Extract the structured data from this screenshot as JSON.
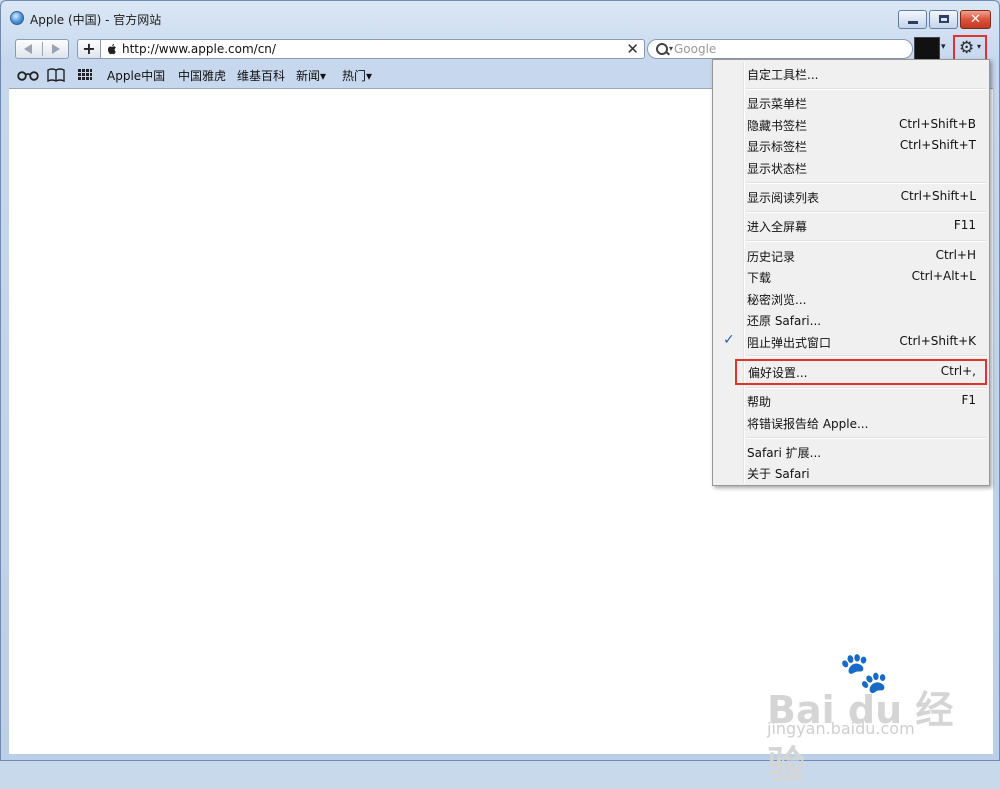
{
  "window": {
    "title": "Apple (中国) - 官方网站",
    "min_glyph": "",
    "max_glyph": "",
    "close_glyph": "✕"
  },
  "toolbar": {
    "add_label": "+",
    "url": "http://www.apple.com/cn/",
    "clear_glyph": "✕",
    "search_placeholder": "Google",
    "search_caret": "▾",
    "page_caret": "▾",
    "gear_glyph": "⚙",
    "gear_caret": "▾"
  },
  "bookmarks": {
    "reading_icon": "glasses-icon",
    "bookmarks_icon": "open-book-icon",
    "topsites_icon": "grid-icon",
    "items": [
      "Apple中国",
      "中国雅虎",
      "维基百科",
      "新闻▾",
      "热门▾"
    ]
  },
  "menu": {
    "items": [
      {
        "label": "自定工具栏...",
        "shortcut": ""
      },
      {
        "label": "显示菜单栏",
        "shortcut": ""
      },
      {
        "label": "隐藏书签栏",
        "shortcut": "Ctrl+Shift+B"
      },
      {
        "label": "显示标签栏",
        "shortcut": "Ctrl+Shift+T"
      },
      {
        "label": "显示状态栏",
        "shortcut": ""
      },
      {
        "label": "显示阅读列表",
        "shortcut": "Ctrl+Shift+L"
      },
      {
        "label": "进入全屏幕",
        "shortcut": "F11"
      },
      {
        "label": "历史记录",
        "shortcut": "Ctrl+H"
      },
      {
        "label": "下载",
        "shortcut": "Ctrl+Alt+L"
      },
      {
        "label": "秘密浏览...",
        "shortcut": ""
      },
      {
        "label": "还原 Safari...",
        "shortcut": ""
      },
      {
        "label": "阻止弹出式窗口",
        "shortcut": "Ctrl+Shift+K",
        "checked": true,
        "check_glyph": "✓"
      },
      {
        "label": "偏好设置...",
        "shortcut": "Ctrl+,",
        "highlighted": true
      },
      {
        "label": "帮助",
        "shortcut": "F1"
      },
      {
        "label": "将错误报告给 Apple...",
        "shortcut": ""
      },
      {
        "label": "Safari 扩展...",
        "shortcut": ""
      },
      {
        "label": "关于 Safari",
        "shortcut": ""
      }
    ]
  },
  "watermark": {
    "logo": "Bai du 经验",
    "url": "jingyan.baidu.com"
  },
  "colors": {
    "highlight_border": "#e3312b",
    "check": "#2a5fa8"
  }
}
